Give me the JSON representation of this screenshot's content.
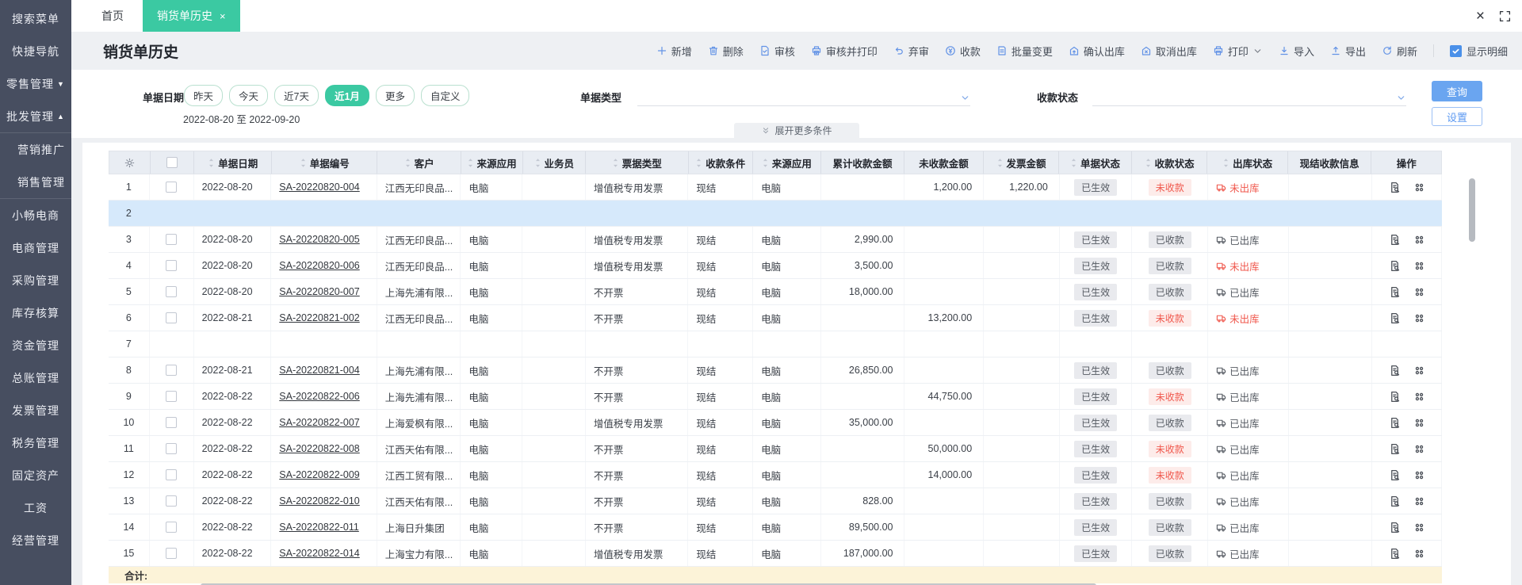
{
  "colors": {
    "accent_green": "#3bc9a2",
    "toolbar_icon_blue": "#6393e6",
    "primary_button_blue": "#6aa5f0",
    "danger_red": "#f0584d",
    "sidebar_bg": "#474e60",
    "selected_row_bg": "#d6e9fb",
    "footer_row_bg": "#fcf3d8"
  },
  "sidebar": {
    "items": [
      {
        "label": "搜索菜单"
      },
      {
        "label": "快捷导航"
      },
      {
        "label": "零售管理",
        "arrow": "down"
      },
      {
        "label": "批发管理",
        "arrow": "up"
      },
      {
        "label": "营销推广",
        "sub": true,
        "sep_before": true
      },
      {
        "label": "销售管理",
        "sub": true
      },
      {
        "label": "小畅电商",
        "sep_before": true
      },
      {
        "label": "电商管理"
      },
      {
        "label": "采购管理"
      },
      {
        "label": "库存核算"
      },
      {
        "label": "资金管理"
      },
      {
        "label": "总账管理"
      },
      {
        "label": "发票管理"
      },
      {
        "label": "税务管理"
      },
      {
        "label": "固定资产"
      },
      {
        "label": "工资"
      },
      {
        "label": "经营管理"
      }
    ]
  },
  "tabs": {
    "items": [
      {
        "label": "首页",
        "active": false,
        "closable": false
      },
      {
        "label": "销货单历史",
        "active": true,
        "closable": true
      }
    ],
    "close_glyph": "×"
  },
  "window_controls": {
    "close_glyph": "×"
  },
  "page": {
    "title": "销货单历史"
  },
  "toolbar": {
    "buttons": [
      {
        "label": "新增",
        "icon": "plus-icon"
      },
      {
        "label": "删除",
        "icon": "trash-icon"
      },
      {
        "label": "审核",
        "icon": "audit-icon"
      },
      {
        "label": "审核并打印",
        "icon": "audit-print-icon"
      },
      {
        "label": "弃审",
        "icon": "abandon-icon"
      },
      {
        "label": "收款",
        "icon": "collect-icon"
      },
      {
        "label": "批量变更",
        "icon": "batch-change-icon"
      },
      {
        "label": "确认出库",
        "icon": "confirm-out-icon"
      },
      {
        "label": "取消出库",
        "icon": "cancel-out-icon"
      },
      {
        "label": "打印",
        "icon": "print-icon",
        "dropdown": true
      },
      {
        "label": "导入",
        "icon": "import-icon"
      },
      {
        "label": "导出",
        "icon": "export-icon"
      },
      {
        "label": "刷新",
        "icon": "refresh-icon"
      }
    ],
    "detail_toggle": {
      "label": "显示明细",
      "checked": true
    }
  },
  "filter": {
    "date_label": "单据日期",
    "pills": [
      {
        "label": "昨天"
      },
      {
        "label": "今天"
      },
      {
        "label": "近7天"
      },
      {
        "label": "近1月",
        "active": true
      },
      {
        "label": "更多"
      },
      {
        "label": "自定义"
      }
    ],
    "date_range": "2022-08-20 至 2022-09-20",
    "type_label": "单据类型",
    "type_value": "",
    "pay_label": "收款状态",
    "pay_value": "",
    "query_button": "查询",
    "settings_button": "设置",
    "expand_more": "展开更多条件"
  },
  "table": {
    "columns": [
      {
        "key": "num",
        "label": "",
        "header_icon": "gear-icon"
      },
      {
        "key": "cb",
        "label": "",
        "header_checkbox": true
      },
      {
        "key": "date",
        "label": "单据日期",
        "sortable": true
      },
      {
        "key": "docno",
        "label": "单据编号",
        "sortable": true
      },
      {
        "key": "customer",
        "label": "客户",
        "sortable": true
      },
      {
        "key": "src_app",
        "label": "来源应用",
        "sortable": true
      },
      {
        "key": "salesperson",
        "label": "业务员",
        "sortable": true
      },
      {
        "key": "ticket_type",
        "label": "票据类型",
        "sortable": true
      },
      {
        "key": "pay_cond",
        "label": "收款条件",
        "sortable": true
      },
      {
        "key": "src_app2",
        "label": "来源应用",
        "sortable": true
      },
      {
        "key": "recv_total",
        "label": "累计收款金额",
        "sortable": false
      },
      {
        "key": "unrecv",
        "label": "未收款金额",
        "sortable": false
      },
      {
        "key": "invoice",
        "label": "发票金额",
        "sortable": true
      },
      {
        "key": "doc_status",
        "label": "单据状态",
        "sortable": true
      },
      {
        "key": "pay_status",
        "label": "收款状态",
        "sortable": true
      },
      {
        "key": "out_status",
        "label": "出库状态",
        "sortable": true
      },
      {
        "key": "cash_info",
        "label": "现结收款信息",
        "sortable": false
      },
      {
        "key": "op",
        "label": "操作",
        "sortable": false
      }
    ],
    "rows": [
      {
        "num": "1",
        "date": "2022-08-20",
        "docno": "SA-20220820-004",
        "customer": "江西无印良品...",
        "src_app": "电脑",
        "salesperson": "",
        "ticket_type": "增值税专用发票",
        "pay_cond": "现结",
        "src_app2": "电脑",
        "recv_total": "",
        "unrecv": "1,200.00",
        "invoice": "1,220.00",
        "doc_status": "已生效",
        "pay_status": "未收款",
        "pay_red": true,
        "out_status": "未出库",
        "out_red": true
      },
      {
        "num": "2",
        "empty": true,
        "selected": true
      },
      {
        "num": "3",
        "date": "2022-08-20",
        "docno": "SA-20220820-005",
        "customer": "江西无印良品...",
        "src_app": "电脑",
        "salesperson": "",
        "ticket_type": "增值税专用发票",
        "pay_cond": "现结",
        "src_app2": "电脑",
        "recv_total": "2,990.00",
        "unrecv": "",
        "invoice": "",
        "doc_status": "已生效",
        "pay_status": "已收款",
        "pay_red": false,
        "out_status": "已出库",
        "out_red": false
      },
      {
        "num": "4",
        "date": "2022-08-20",
        "docno": "SA-20220820-006",
        "customer": "江西无印良品...",
        "src_app": "电脑",
        "salesperson": "",
        "ticket_type": "增值税专用发票",
        "pay_cond": "现结",
        "src_app2": "电脑",
        "recv_total": "3,500.00",
        "unrecv": "",
        "invoice": "",
        "doc_status": "已生效",
        "pay_status": "已收款",
        "pay_red": false,
        "out_status": "未出库",
        "out_red": true
      },
      {
        "num": "5",
        "date": "2022-08-20",
        "docno": "SA-20220820-007",
        "customer": "上海先浦有限...",
        "src_app": "电脑",
        "salesperson": "",
        "ticket_type": "不开票",
        "pay_cond": "现结",
        "src_app2": "电脑",
        "recv_total": "18,000.00",
        "unrecv": "",
        "invoice": "",
        "doc_status": "已生效",
        "pay_status": "已收款",
        "pay_red": false,
        "out_status": "已出库",
        "out_red": false
      },
      {
        "num": "6",
        "date": "2022-08-21",
        "docno": "SA-20220821-002",
        "customer": "江西无印良品...",
        "src_app": "电脑",
        "salesperson": "",
        "ticket_type": "不开票",
        "pay_cond": "现结",
        "src_app2": "电脑",
        "recv_total": "",
        "unrecv": "13,200.00",
        "invoice": "",
        "doc_status": "已生效",
        "pay_status": "未收款",
        "pay_red": true,
        "out_status": "未出库",
        "out_red": true
      },
      {
        "num": "7",
        "empty": true
      },
      {
        "num": "8",
        "date": "2022-08-21",
        "docno": "SA-20220821-004",
        "customer": "上海先浦有限...",
        "src_app": "电脑",
        "salesperson": "",
        "ticket_type": "不开票",
        "pay_cond": "现结",
        "src_app2": "电脑",
        "recv_total": "26,850.00",
        "unrecv": "",
        "invoice": "",
        "doc_status": "已生效",
        "pay_status": "已收款",
        "pay_red": false,
        "out_status": "已出库",
        "out_red": false
      },
      {
        "num": "9",
        "date": "2022-08-22",
        "docno": "SA-20220822-006",
        "customer": "上海先浦有限...",
        "src_app": "电脑",
        "salesperson": "",
        "ticket_type": "不开票",
        "pay_cond": "现结",
        "src_app2": "电脑",
        "recv_total": "",
        "unrecv": "44,750.00",
        "invoice": "",
        "doc_status": "已生效",
        "pay_status": "未收款",
        "pay_red": true,
        "out_status": "已出库",
        "out_red": false
      },
      {
        "num": "10",
        "date": "2022-08-22",
        "docno": "SA-20220822-007",
        "customer": "上海爱枫有限...",
        "src_app": "电脑",
        "salesperson": "",
        "ticket_type": "增值税专用发票",
        "pay_cond": "现结",
        "src_app2": "电脑",
        "recv_total": "35,000.00",
        "unrecv": "",
        "invoice": "",
        "doc_status": "已生效",
        "pay_status": "已收款",
        "pay_red": false,
        "out_status": "已出库",
        "out_red": false
      },
      {
        "num": "11",
        "date": "2022-08-22",
        "docno": "SA-20220822-008",
        "customer": "江西天佑有限...",
        "src_app": "电脑",
        "salesperson": "",
        "ticket_type": "不开票",
        "pay_cond": "现结",
        "src_app2": "电脑",
        "recv_total": "",
        "unrecv": "50,000.00",
        "invoice": "",
        "doc_status": "已生效",
        "pay_status": "未收款",
        "pay_red": true,
        "out_status": "已出库",
        "out_red": false
      },
      {
        "num": "12",
        "date": "2022-08-22",
        "docno": "SA-20220822-009",
        "customer": "江西工贸有限...",
        "src_app": "电脑",
        "salesperson": "",
        "ticket_type": "不开票",
        "pay_cond": "现结",
        "src_app2": "电脑",
        "recv_total": "",
        "unrecv": "14,000.00",
        "invoice": "",
        "doc_status": "已生效",
        "pay_status": "未收款",
        "pay_red": true,
        "out_status": "已出库",
        "out_red": false
      },
      {
        "num": "13",
        "date": "2022-08-22",
        "docno": "SA-20220822-010",
        "customer": "江西天佑有限...",
        "src_app": "电脑",
        "salesperson": "",
        "ticket_type": "不开票",
        "pay_cond": "现结",
        "src_app2": "电脑",
        "recv_total": "828.00",
        "unrecv": "",
        "invoice": "",
        "doc_status": "已生效",
        "pay_status": "已收款",
        "pay_red": false,
        "out_status": "已出库",
        "out_red": false
      },
      {
        "num": "14",
        "date": "2022-08-22",
        "docno": "SA-20220822-011",
        "customer": "上海日升集团",
        "src_app": "电脑",
        "salesperson": "",
        "ticket_type": "不开票",
        "pay_cond": "现结",
        "src_app2": "电脑",
        "recv_total": "89,500.00",
        "unrecv": "",
        "invoice": "",
        "doc_status": "已生效",
        "pay_status": "已收款",
        "pay_red": false,
        "out_status": "已出库",
        "out_red": false
      },
      {
        "num": "15",
        "date": "2022-08-22",
        "docno": "SA-20220822-014",
        "customer": "上海宝力有限...",
        "src_app": "电脑",
        "salesperson": "",
        "ticket_type": "增值税专用发票",
        "pay_cond": "现结",
        "src_app2": "电脑",
        "recv_total": "187,000.00",
        "unrecv": "",
        "invoice": "",
        "doc_status": "已生效",
        "pay_status": "已收款",
        "pay_red": false,
        "out_status": "已出库",
        "out_red": false
      }
    ],
    "footer_label": "合计:"
  }
}
